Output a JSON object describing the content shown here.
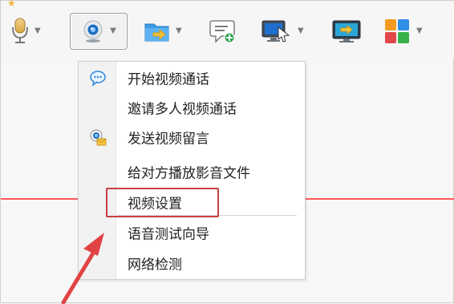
{
  "toolbar": {
    "buttons": [
      {
        "icon": "microphone-icon"
      },
      {
        "icon": "webcam-icon"
      },
      {
        "icon": "folder-icon"
      },
      {
        "icon": "message-plus-icon"
      },
      {
        "icon": "monitor-cursor-icon"
      },
      {
        "icon": "desktop-arrow-icon"
      },
      {
        "icon": "apps-grid-icon"
      }
    ]
  },
  "menu": {
    "items": [
      {
        "label": "开始视频通话",
        "icon": "chat-bubble-icon"
      },
      {
        "label": "邀请多人视频通话"
      },
      {
        "label": "发送视频留言",
        "icon": "video-message-icon"
      },
      {
        "label": "给对方播放影音文件"
      },
      {
        "label": "视频设置",
        "highlighted": true
      },
      {
        "label": "语音测试向导"
      },
      {
        "label": "网络检测"
      }
    ]
  },
  "annotation": {
    "highlight_color": "#c83f3f",
    "arrow_color": "#e04343"
  }
}
